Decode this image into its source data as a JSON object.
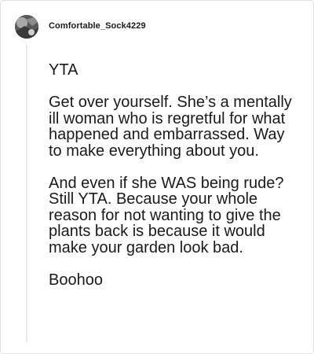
{
  "comment": {
    "author": "Comfortable_Sock4229",
    "avatar_icon": "user-avatar-icon",
    "paragraphs": [
      "YTA",
      "Get over yourself. She’s a mentally ill woman who is regretful for what happened and embarrassed. Way to make everything about you.",
      "And even if she WAS being rude? Still YTA. Because your whole reason for not wanting to give the plants back is because it would make your garden look bad.",
      "Boohoo"
    ]
  },
  "colors": {
    "text": "#1a1a1b",
    "thread_line": "#e9e9e9",
    "card_border": "#e3e3e3"
  }
}
